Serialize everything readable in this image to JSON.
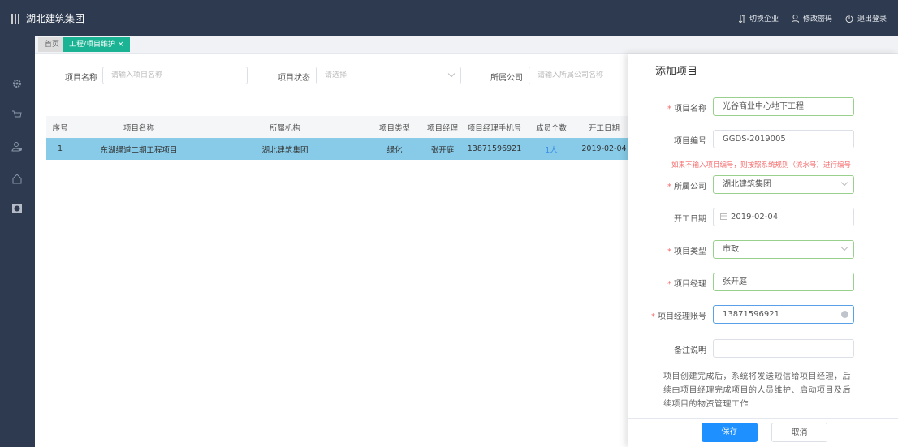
{
  "header": {
    "title": "湖北建筑集团",
    "links": [
      {
        "label": "切换企业",
        "icon": "switch-icon"
      },
      {
        "label": "修改密码",
        "icon": "user-icon"
      },
      {
        "label": "退出登录",
        "icon": "power-icon"
      }
    ]
  },
  "sidebar": {
    "icons": [
      "gear-icon",
      "cart-icon",
      "user-settings-icon",
      "home-icon",
      "chart-icon"
    ]
  },
  "breadcrumb": {
    "home": "首页",
    "active": "工程/项目维护",
    "close": "×"
  },
  "filters": {
    "name": {
      "label": "项目名称",
      "placeholder": "请输入项目名称"
    },
    "status": {
      "label": "项目状态",
      "placeholder": "请选择"
    },
    "company": {
      "label": "所属公司",
      "placeholder": "请输入所属公司名称"
    }
  },
  "table": {
    "headers": [
      "序号",
      "项目名称",
      "所属机构",
      "项目类型",
      "项目经理",
      "项目经理手机号",
      "成员个数",
      "开工日期"
    ],
    "rows": [
      [
        "1",
        "东湖绿道二期工程项目",
        "湖北建筑集团",
        "绿化",
        "张开庭",
        "13871596921",
        "1人",
        "2019-02-04"
      ]
    ]
  },
  "panel": {
    "title": "添加项目",
    "fields": {
      "name": {
        "label": "项目名称",
        "value": "光谷商业中心地下工程",
        "required": true
      },
      "code": {
        "label": "项目编号",
        "value": "GGDS-2019005"
      },
      "note": "如果不输入项目编号，则按照系统规则（流水号）进行编号",
      "company": {
        "label": "所属公司",
        "value": "湖北建筑集团",
        "required": true
      },
      "start": {
        "label": "开工日期",
        "value": "2019-02-04"
      },
      "type": {
        "label": "项目类型",
        "value": "市政",
        "required": true
      },
      "manager": {
        "label": "项目经理",
        "value": "张开庭",
        "required": true
      },
      "account": {
        "label": "项目经理账号",
        "value": "13871596921",
        "required": true
      },
      "remark": {
        "label": "备注说明",
        "value": ""
      }
    },
    "description": "项目创建完成后，系统将发送短信给项目经理，后续由项目经理完成项目的人员维护、启动项目及后续项目的物资管理工作",
    "save": "保存",
    "cancel": "取消"
  },
  "colors": {
    "topbar": "#2d3a4f",
    "accent": "#1ab394",
    "selected_row": "#87cbe8",
    "primary": "#1e90ff",
    "required": "#f56c6c"
  }
}
